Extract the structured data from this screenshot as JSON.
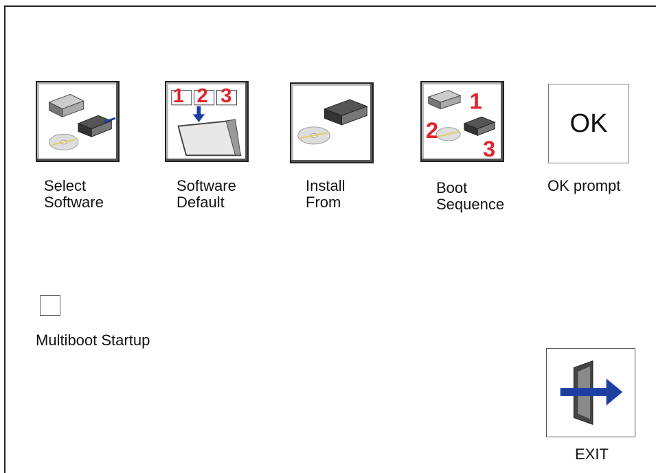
{
  "tiles": [
    {
      "label": "Select\nSoftware",
      "icon": "select-software-icon"
    },
    {
      "label": "Software\nDefault",
      "icon": "software-default-icon"
    },
    {
      "label": "Install\nFrom",
      "icon": "install-from-icon"
    },
    {
      "label": "Boot\nSequence",
      "icon": "boot-sequence-icon"
    }
  ],
  "ok": {
    "button_text": "OK",
    "label": "OK prompt"
  },
  "multiboot": {
    "label": "Multiboot Startup",
    "checked": false
  },
  "exit": {
    "label": "EXIT"
  },
  "number_marks": [
    "1",
    "2",
    "3"
  ],
  "colors": {
    "accent_red": "#e3242b",
    "arrow_blue": "#1f3fa0"
  }
}
